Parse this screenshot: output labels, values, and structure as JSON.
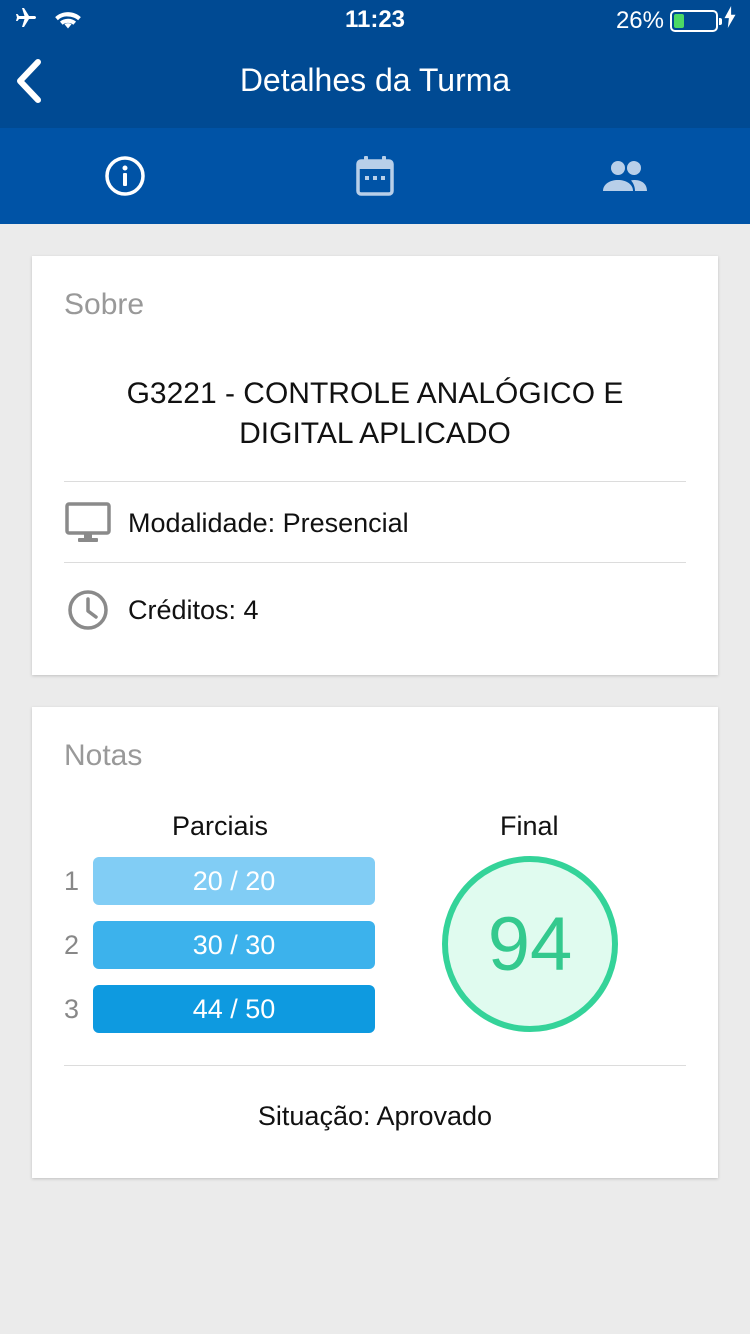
{
  "status_bar": {
    "time": "11:23",
    "battery_percent": "26%",
    "battery_level": 0.26,
    "icons": [
      "airplane-icon",
      "wifi-icon",
      "battery-icon",
      "charging-bolt-icon"
    ]
  },
  "nav": {
    "title": "Detalhes da Turma",
    "back_icon": "chevron-left-icon"
  },
  "tabs": [
    {
      "icon": "info-icon",
      "active": true
    },
    {
      "icon": "calendar-icon",
      "active": false
    },
    {
      "icon": "people-icon",
      "active": false
    }
  ],
  "about": {
    "heading": "Sobre",
    "course_title": "G3221 - CONTROLE ANALÓGICO E DIGITAL APLICADO",
    "modality": "Modalidade: Presencial",
    "credits": "Créditos: 4"
  },
  "grades": {
    "heading": "Notas",
    "partials_label": "Parciais",
    "final_label": "Final",
    "partials": [
      {
        "index": "1",
        "value": "20 / 20",
        "color": "#81cdf5"
      },
      {
        "index": "2",
        "value": "30 / 30",
        "color": "#3cb2ec"
      },
      {
        "index": "3",
        "value": "44 / 50",
        "color": "#0e9ae0"
      }
    ],
    "final_value": "94",
    "situation": "Situação: Aprovado"
  },
  "colors": {
    "header_blue": "#004a93",
    "tab_blue": "#0053a6",
    "final_green": "#34d399"
  }
}
